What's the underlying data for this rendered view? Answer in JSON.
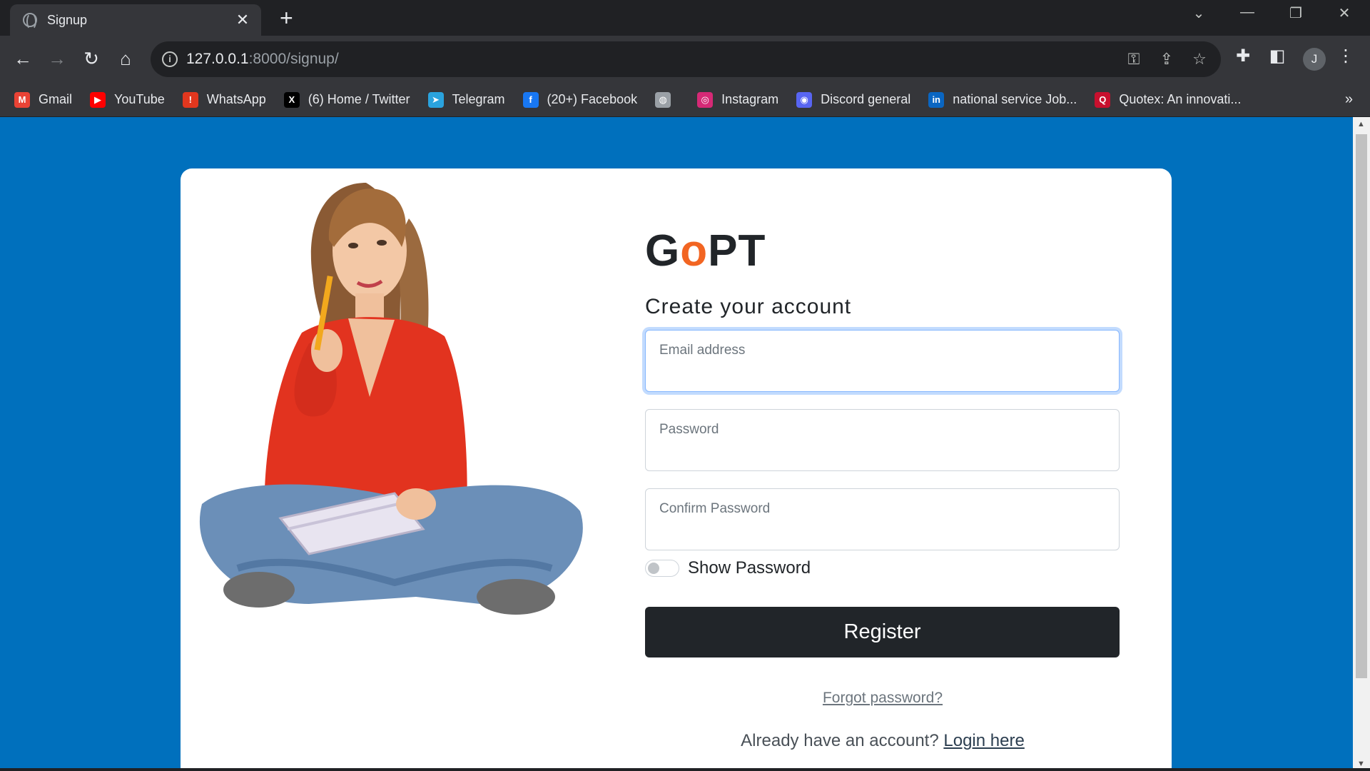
{
  "browser": {
    "tab_title": "Signup",
    "tab_close": "✕",
    "new_tab": "+",
    "url_host": "127.0.0.1",
    "url_path": ":8000/signup/",
    "avatar_letter": "J",
    "bookmarks": [
      {
        "label": "Gmail",
        "icon": "gmail-icon",
        "color": "#ea4335",
        "glyph": "M"
      },
      {
        "label": "YouTube",
        "icon": "youtube-icon",
        "color": "#ff0000",
        "glyph": "▶"
      },
      {
        "label": "WhatsApp",
        "icon": "whatsapp-icon",
        "color": "#e2371e",
        "glyph": "!"
      },
      {
        "label": "(6) Home / Twitter",
        "icon": "x-twitter-icon",
        "color": "#000000",
        "glyph": "X"
      },
      {
        "label": "Telegram",
        "icon": "telegram-icon",
        "color": "#2aa3de",
        "glyph": "➤"
      },
      {
        "label": "(20+) Facebook",
        "icon": "facebook-icon",
        "color": "#1877f2",
        "glyph": "f"
      },
      {
        "label": "",
        "icon": "globe-icon",
        "color": "#9aa0a6",
        "glyph": "◍"
      },
      {
        "label": "Instagram",
        "icon": "instagram-icon",
        "color": "#d62976",
        "glyph": "◎"
      },
      {
        "label": "Discord general",
        "icon": "discord-icon",
        "color": "#5865f2",
        "glyph": "◉"
      },
      {
        "label": "national service Job...",
        "icon": "linkedin-icon",
        "color": "#0a66c2",
        "glyph": "in"
      },
      {
        "label": "Quotex: An innovati...",
        "icon": "quotex-icon",
        "color": "#c8102e",
        "glyph": "Q"
      }
    ],
    "bookmarks_more": "»"
  },
  "page": {
    "brand_prefix": "G",
    "brand_o": "o",
    "brand_suffix": "PT",
    "heading": "Create your account",
    "email_placeholder": "Email address",
    "password_placeholder": "Password",
    "confirm_placeholder": "Confirm Password",
    "show_password_label": "Show Password",
    "register_label": "Register",
    "forgot_label": "Forgot password?",
    "already_text": "Already have an account?",
    "login_label": "Login here"
  },
  "colors": {
    "page_background": "#0070bd",
    "brand_accent": "#f26522",
    "button_dark": "#212529"
  }
}
